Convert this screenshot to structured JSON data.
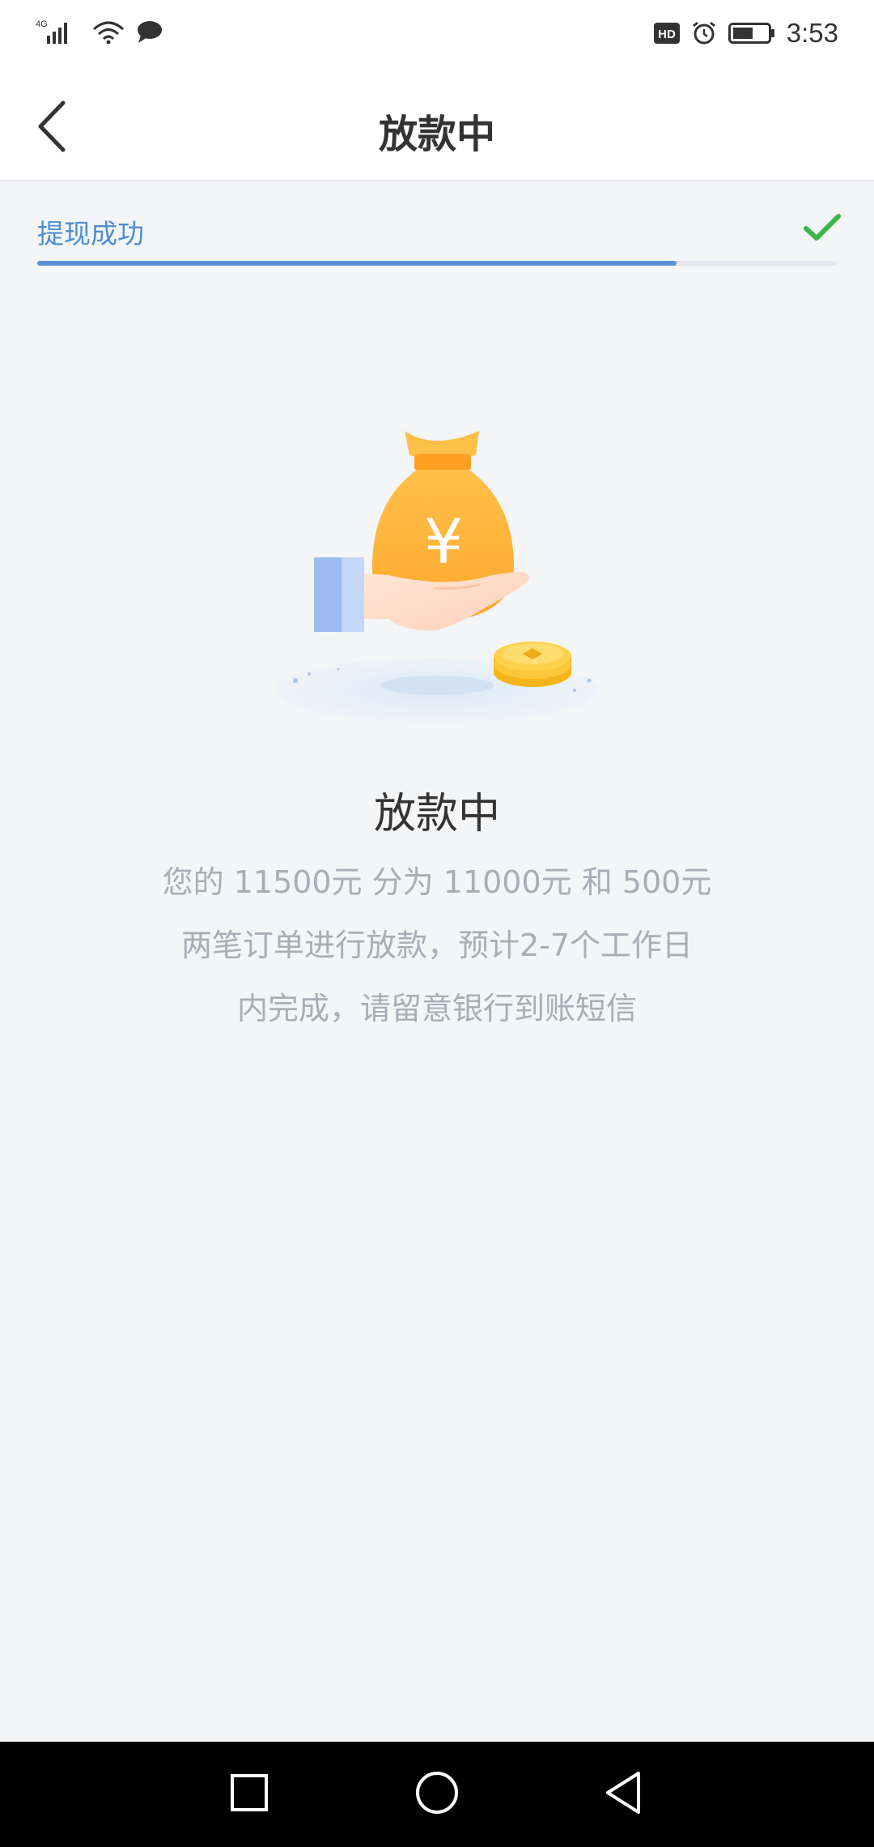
{
  "status_bar": {
    "network": "4G",
    "time": "3:53",
    "hd_label": "HD"
  },
  "header": {
    "title": "放款中"
  },
  "progress": {
    "label": "提现成功",
    "fraction": 0.8,
    "accent": "#5c93d8",
    "check_color": "#3cb54a"
  },
  "content": {
    "title": "放款中",
    "lines": [
      "您的 11500元 分为 11000元 和 500元",
      "两笔订单进行放款，预计2-7个工作日",
      "内完成，请留意银行到账短信"
    ],
    "illustration_symbol": "¥"
  },
  "icons": {
    "back": "chevron-left-icon",
    "check": "check-icon",
    "nav_recents": "square-icon",
    "nav_home": "circle-icon",
    "nav_back": "triangle-back-icon"
  }
}
